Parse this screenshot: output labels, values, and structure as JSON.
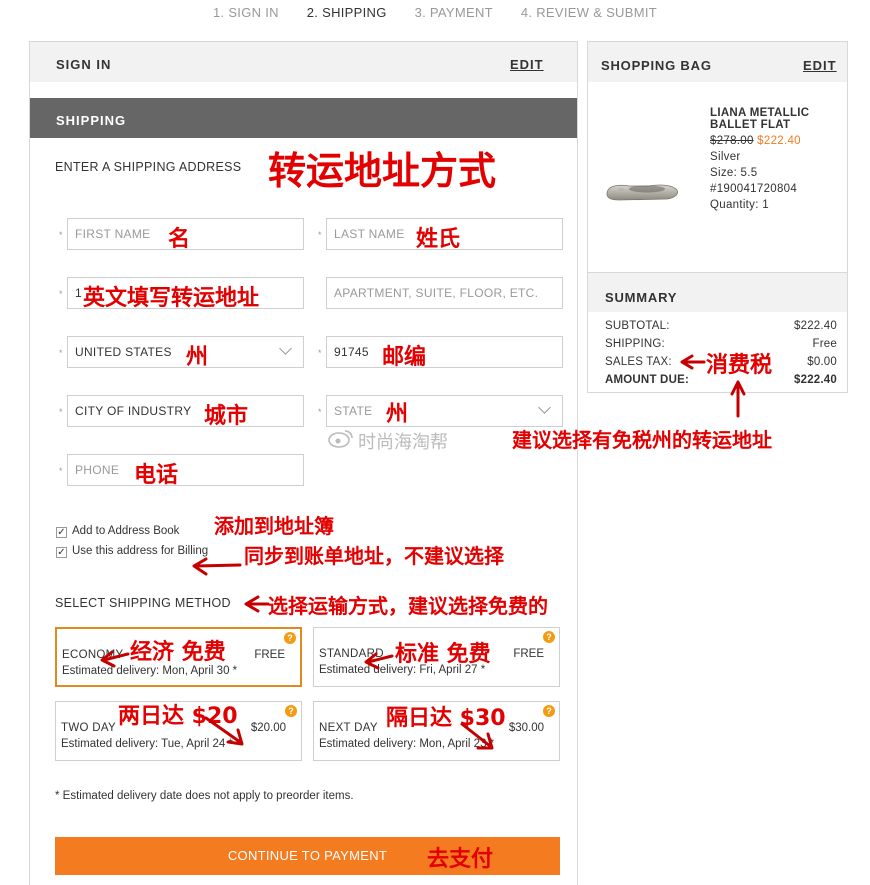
{
  "steps": {
    "signin": "1. SIGN IN",
    "shipping": "2. SHIPPING",
    "payment": "3. PAYMENT",
    "review": "4. REVIEW & SUBMIT"
  },
  "signin_section": {
    "title": "SIGN IN",
    "edit": "EDIT"
  },
  "shipping_section": {
    "title": "SHIPPING",
    "address_heading": "ENTER A SHIPPING ADDRESS",
    "first_name_placeholder": "FIRST NAME",
    "last_name_placeholder": "LAST NAME",
    "address1_value": "1",
    "address2_placeholder": "APARTMENT, SUITE, FLOOR, ETC.",
    "country_value": "UNITED STATES",
    "zip_value": "91745",
    "city_value": "CITY OF INDUSTRY",
    "state_placeholder": "STATE",
    "phone_placeholder": "PHONE",
    "required_mark": "*",
    "add_to_address_book": "Add to Address Book",
    "use_for_billing": "Use this address for Billing",
    "check_mark": "✓",
    "method_heading": "SELECT SHIPPING METHOD",
    "options": [
      {
        "name": "ECONOMY",
        "price": "FREE",
        "estimate": "Estimated delivery: Mon, April 30 *",
        "selected": true
      },
      {
        "name": "STANDARD",
        "price": "FREE",
        "estimate": "Estimated delivery: Fri, April 27 *",
        "selected": false
      },
      {
        "name": "TWO DAY",
        "price": "$20.00",
        "estimate": "Estimated delivery: Tue, April 24 *",
        "selected": false
      },
      {
        "name": "NEXT DAY",
        "price": "$30.00",
        "estimate": "Estimated delivery: Mon, April 23 *",
        "selected": false
      }
    ],
    "help_glyph": "?",
    "footnote": "* Estimated delivery date does not apply to preorder items.",
    "continue_button": "CONTINUE TO PAYMENT"
  },
  "bag": {
    "title": "SHOPPING BAG",
    "edit": "EDIT",
    "product": {
      "name": "LIANA METALLIC BALLET FLAT",
      "original_price": "$278.00",
      "sale_price": "$222.40",
      "color": "Silver",
      "size": "Size:  5.5",
      "sku": "#190041720804",
      "quantity": "Quantity: 1"
    }
  },
  "summary": {
    "title": "SUMMARY",
    "rows": [
      {
        "label": "SUBTOTAL:",
        "value": "$222.40"
      },
      {
        "label": "SHIPPING:",
        "value": "Free"
      },
      {
        "label": "SALES TAX:",
        "value": "$0.00"
      },
      {
        "label": "AMOUNT DUE:",
        "value": "$222.40"
      }
    ]
  },
  "annotations": {
    "heading": "转运地址方式",
    "first_name": "名",
    "last_name": "姓氏",
    "address": "英文填写转运地址",
    "country_state": "州",
    "zip": "邮编",
    "city": "城市",
    "state": "州",
    "phone": "电话",
    "address_book": "添加到地址簿",
    "billing": "同步到账单地址，不建议选择",
    "method": "选择运输方式，建议选择免费的",
    "economy": "经济 免费",
    "standard": "标准 免费",
    "two_day": "两日达 $20",
    "next_day": "隔日达 $30",
    "sales_tax": "消费税",
    "tax_free_tip": "建议选择有免税州的转运地址",
    "continue": "去支付",
    "watermark": "时尚海淘帮"
  },
  "colors": {
    "accent": "#f47b20",
    "annotation": "#e20000",
    "selected_border": "#e0891f"
  }
}
